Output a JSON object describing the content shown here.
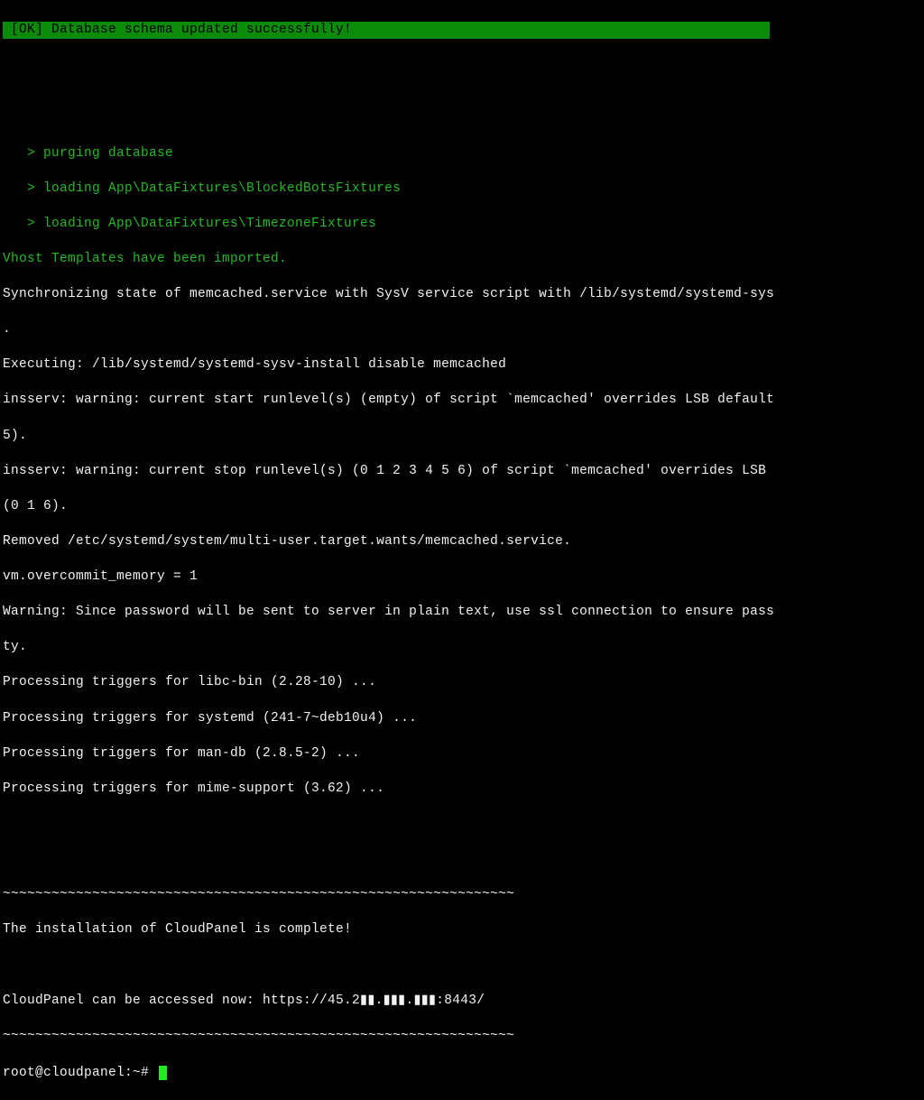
{
  "banner": {
    "text": " [OK] Database schema updated successfully!"
  },
  "fixtures": {
    "line1": "   > purging database",
    "line2": "   > loading App\\DataFixtures\\BlockedBotsFixtures",
    "line3": "   > loading App\\DataFixtures\\TimezoneFixtures",
    "imported": "Vhost Templates have been imported."
  },
  "output": {
    "line1": "Synchronizing state of memcached.service with SysV service script with /lib/systemd/systemd-sys",
    "line2": ".",
    "line3": "Executing: /lib/systemd/systemd-sysv-install disable memcached",
    "line4": "insserv: warning: current start runlevel(s) (empty) of script `memcached' overrides LSB default",
    "line5": "5).",
    "line6": "insserv: warning: current stop runlevel(s) (0 1 2 3 4 5 6) of script `memcached' overrides LSB",
    "line7": "(0 1 6).",
    "line8": "Removed /etc/systemd/system/multi-user.target.wants/memcached.service.",
    "line9": "vm.overcommit_memory = 1",
    "line10": "Warning: Since password will be sent to server in plain text, use ssl connection to ensure pass",
    "line11": "ty.",
    "line12": "Processing triggers for libc-bin (2.28-10) ...",
    "line13": "Processing triggers for systemd (241-7~deb10u4) ...",
    "line14": "Processing triggers for man-db (2.8.5-2) ...",
    "line15": "Processing triggers for mime-support (3.62) ..."
  },
  "completion": {
    "divider": "~~~~~~~~~~~~~~~~~~~~~~~~~~~~~~~~~~~~~~~~~~~~~~~~~~~~~~~~~~~~~~~",
    "message": "The installation of CloudPanel is complete!",
    "access": "CloudPanel can be accessed now: https://45.2▮▮.▮▮▮.▮▮▮:8443/"
  },
  "prompt": {
    "text": "root@cloudpanel:~# "
  }
}
